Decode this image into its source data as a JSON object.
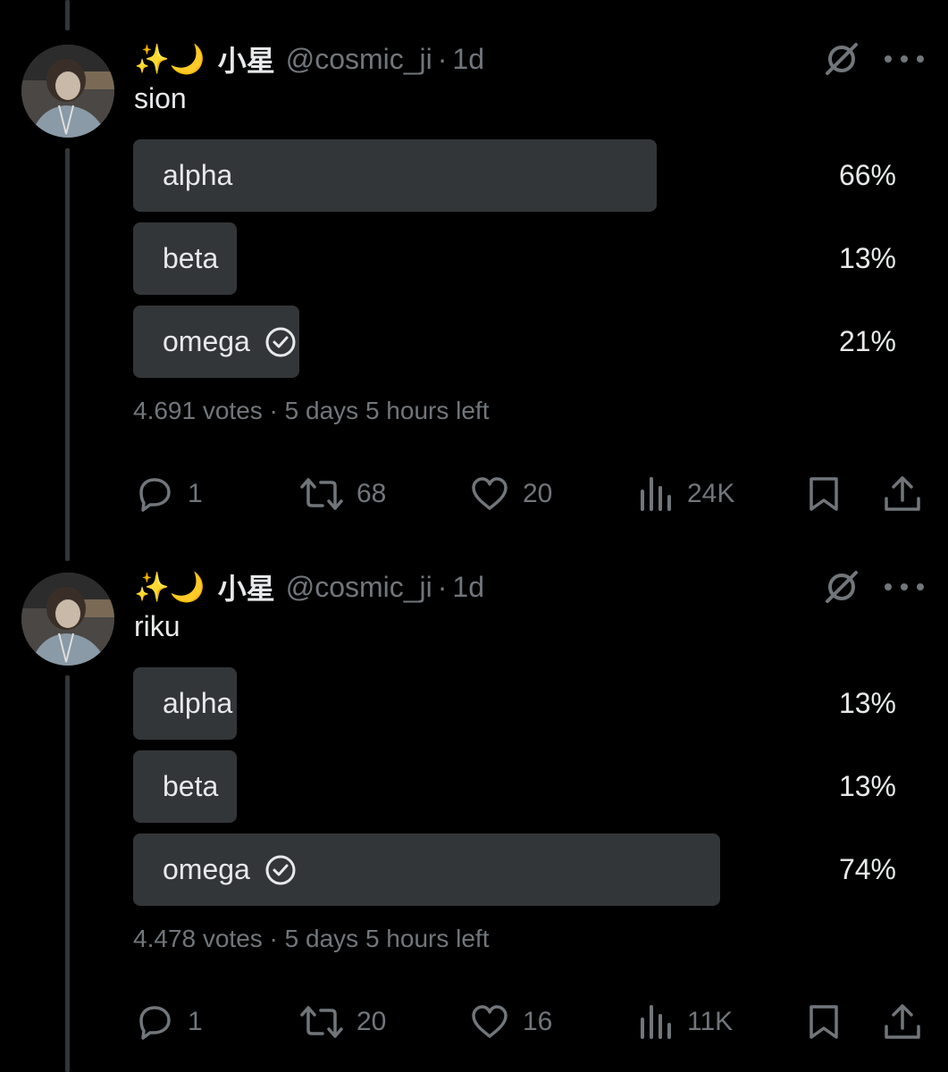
{
  "tweets": [
    {
      "author": {
        "emoji": "✨🌙",
        "name": "小星",
        "handle": "@cosmic_ji",
        "time": "1d"
      },
      "text": "sion",
      "poll": {
        "options": [
          {
            "label": "alpha",
            "percent": "66%",
            "fraction": 0.68,
            "selected": false
          },
          {
            "label": "beta",
            "percent": "13%",
            "fraction": 0.134,
            "selected": false
          },
          {
            "label": "omega",
            "percent": "21%",
            "fraction": 0.216,
            "selected": true
          }
        ],
        "votes": "4.691 votes",
        "time_left": "5 days 5 hours left"
      },
      "actions": {
        "replies": "1",
        "reposts": "68",
        "likes": "20",
        "views": "24K"
      }
    },
    {
      "author": {
        "emoji": "✨🌙",
        "name": "小星",
        "handle": "@cosmic_ji",
        "time": "1d"
      },
      "text": "riku",
      "poll": {
        "options": [
          {
            "label": "alpha",
            "percent": "13%",
            "fraction": 0.134,
            "selected": false
          },
          {
            "label": "beta",
            "percent": "13%",
            "fraction": 0.134,
            "selected": false
          },
          {
            "label": "omega",
            "percent": "74%",
            "fraction": 0.762,
            "selected": true
          }
        ],
        "votes": "4.478 votes",
        "time_left": "5 days 5 hours left"
      },
      "actions": {
        "replies": "1",
        "reposts": "20",
        "likes": "16",
        "views": "11K"
      }
    }
  ],
  "icons": {
    "grok": "grok-icon",
    "more": "more-icon",
    "reply": "reply-icon",
    "repost": "repost-icon",
    "like": "heart-icon",
    "views": "views-icon",
    "bookmark": "bookmark-icon",
    "share": "share-icon",
    "check": "check-circle-icon"
  },
  "colors": {
    "background": "#000000",
    "bar": "#333639",
    "muted": "#71767b",
    "text": "#e7e9ea"
  }
}
